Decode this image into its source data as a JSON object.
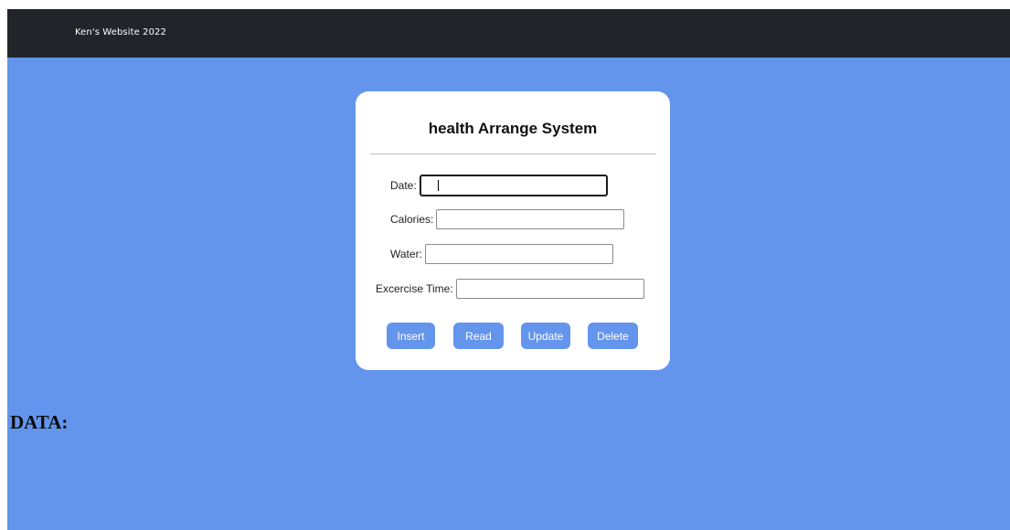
{
  "navbar": {
    "brand": "Ken's Website 2022"
  },
  "form": {
    "title": "health Arrange System",
    "fields": [
      {
        "label": "Date:",
        "value": "",
        "placeholder": ""
      },
      {
        "label": "Calories:",
        "value": "",
        "placeholder": ""
      },
      {
        "label": "Water:",
        "value": "",
        "placeholder": ""
      },
      {
        "label": "Excercise Time:",
        "value": "",
        "placeholder": ""
      }
    ],
    "buttons": {
      "insert": "Insert",
      "read": "Read",
      "update": "Update",
      "delete": "Delete"
    }
  },
  "data_section": {
    "heading": "DATA:"
  },
  "colors": {
    "background": "#6495ed",
    "navbar": "#212529",
    "button": "#6495ed",
    "card": "#ffffff"
  }
}
